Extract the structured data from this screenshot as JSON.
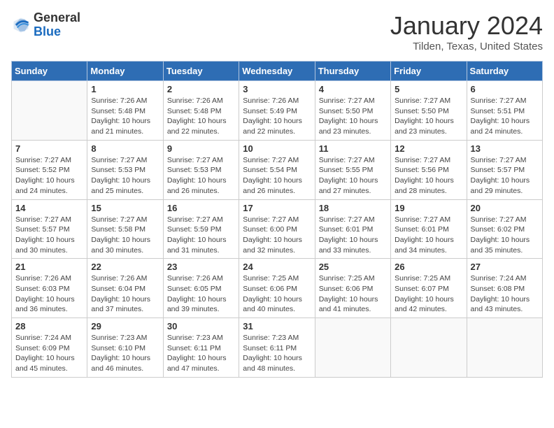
{
  "header": {
    "logo_general": "General",
    "logo_blue": "Blue",
    "title": "January 2024",
    "subtitle": "Tilden, Texas, United States"
  },
  "days_of_week": [
    "Sunday",
    "Monday",
    "Tuesday",
    "Wednesday",
    "Thursday",
    "Friday",
    "Saturday"
  ],
  "weeks": [
    [
      {
        "day": "",
        "info": ""
      },
      {
        "day": "1",
        "info": "Sunrise: 7:26 AM\nSunset: 5:48 PM\nDaylight: 10 hours\nand 21 minutes."
      },
      {
        "day": "2",
        "info": "Sunrise: 7:26 AM\nSunset: 5:48 PM\nDaylight: 10 hours\nand 22 minutes."
      },
      {
        "day": "3",
        "info": "Sunrise: 7:26 AM\nSunset: 5:49 PM\nDaylight: 10 hours\nand 22 minutes."
      },
      {
        "day": "4",
        "info": "Sunrise: 7:27 AM\nSunset: 5:50 PM\nDaylight: 10 hours\nand 23 minutes."
      },
      {
        "day": "5",
        "info": "Sunrise: 7:27 AM\nSunset: 5:50 PM\nDaylight: 10 hours\nand 23 minutes."
      },
      {
        "day": "6",
        "info": "Sunrise: 7:27 AM\nSunset: 5:51 PM\nDaylight: 10 hours\nand 24 minutes."
      }
    ],
    [
      {
        "day": "7",
        "info": "Sunrise: 7:27 AM\nSunset: 5:52 PM\nDaylight: 10 hours\nand 24 minutes."
      },
      {
        "day": "8",
        "info": "Sunrise: 7:27 AM\nSunset: 5:53 PM\nDaylight: 10 hours\nand 25 minutes."
      },
      {
        "day": "9",
        "info": "Sunrise: 7:27 AM\nSunset: 5:53 PM\nDaylight: 10 hours\nand 26 minutes."
      },
      {
        "day": "10",
        "info": "Sunrise: 7:27 AM\nSunset: 5:54 PM\nDaylight: 10 hours\nand 26 minutes."
      },
      {
        "day": "11",
        "info": "Sunrise: 7:27 AM\nSunset: 5:55 PM\nDaylight: 10 hours\nand 27 minutes."
      },
      {
        "day": "12",
        "info": "Sunrise: 7:27 AM\nSunset: 5:56 PM\nDaylight: 10 hours\nand 28 minutes."
      },
      {
        "day": "13",
        "info": "Sunrise: 7:27 AM\nSunset: 5:57 PM\nDaylight: 10 hours\nand 29 minutes."
      }
    ],
    [
      {
        "day": "14",
        "info": "Sunrise: 7:27 AM\nSunset: 5:57 PM\nDaylight: 10 hours\nand 30 minutes."
      },
      {
        "day": "15",
        "info": "Sunrise: 7:27 AM\nSunset: 5:58 PM\nDaylight: 10 hours\nand 30 minutes."
      },
      {
        "day": "16",
        "info": "Sunrise: 7:27 AM\nSunset: 5:59 PM\nDaylight: 10 hours\nand 31 minutes."
      },
      {
        "day": "17",
        "info": "Sunrise: 7:27 AM\nSunset: 6:00 PM\nDaylight: 10 hours\nand 32 minutes."
      },
      {
        "day": "18",
        "info": "Sunrise: 7:27 AM\nSunset: 6:01 PM\nDaylight: 10 hours\nand 33 minutes."
      },
      {
        "day": "19",
        "info": "Sunrise: 7:27 AM\nSunset: 6:01 PM\nDaylight: 10 hours\nand 34 minutes."
      },
      {
        "day": "20",
        "info": "Sunrise: 7:27 AM\nSunset: 6:02 PM\nDaylight: 10 hours\nand 35 minutes."
      }
    ],
    [
      {
        "day": "21",
        "info": "Sunrise: 7:26 AM\nSunset: 6:03 PM\nDaylight: 10 hours\nand 36 minutes."
      },
      {
        "day": "22",
        "info": "Sunrise: 7:26 AM\nSunset: 6:04 PM\nDaylight: 10 hours\nand 37 minutes."
      },
      {
        "day": "23",
        "info": "Sunrise: 7:26 AM\nSunset: 6:05 PM\nDaylight: 10 hours\nand 39 minutes."
      },
      {
        "day": "24",
        "info": "Sunrise: 7:25 AM\nSunset: 6:06 PM\nDaylight: 10 hours\nand 40 minutes."
      },
      {
        "day": "25",
        "info": "Sunrise: 7:25 AM\nSunset: 6:06 PM\nDaylight: 10 hours\nand 41 minutes."
      },
      {
        "day": "26",
        "info": "Sunrise: 7:25 AM\nSunset: 6:07 PM\nDaylight: 10 hours\nand 42 minutes."
      },
      {
        "day": "27",
        "info": "Sunrise: 7:24 AM\nSunset: 6:08 PM\nDaylight: 10 hours\nand 43 minutes."
      }
    ],
    [
      {
        "day": "28",
        "info": "Sunrise: 7:24 AM\nSunset: 6:09 PM\nDaylight: 10 hours\nand 45 minutes."
      },
      {
        "day": "29",
        "info": "Sunrise: 7:23 AM\nSunset: 6:10 PM\nDaylight: 10 hours\nand 46 minutes."
      },
      {
        "day": "30",
        "info": "Sunrise: 7:23 AM\nSunset: 6:11 PM\nDaylight: 10 hours\nand 47 minutes."
      },
      {
        "day": "31",
        "info": "Sunrise: 7:23 AM\nSunset: 6:11 PM\nDaylight: 10 hours\nand 48 minutes."
      },
      {
        "day": "",
        "info": ""
      },
      {
        "day": "",
        "info": ""
      },
      {
        "day": "",
        "info": ""
      }
    ]
  ]
}
